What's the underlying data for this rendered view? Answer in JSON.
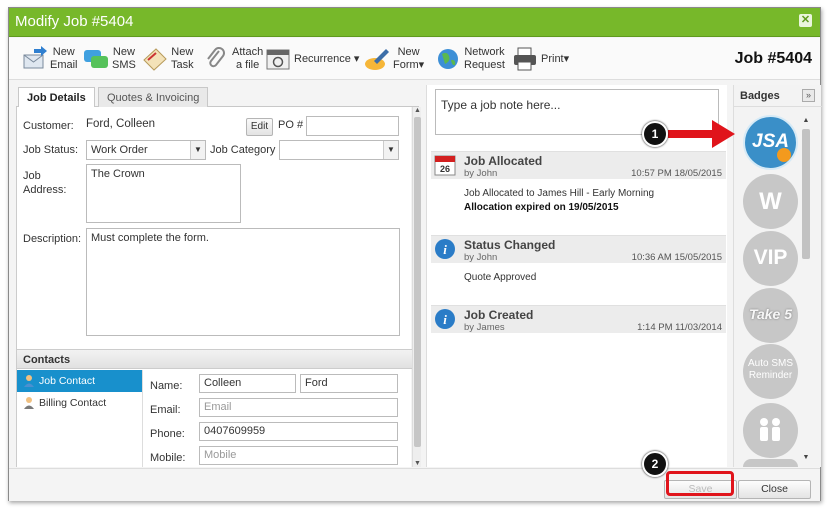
{
  "window": {
    "title": "Modify Job #5404"
  },
  "toolbar": {
    "new_email": [
      "New",
      "Email"
    ],
    "new_sms": [
      "New",
      "SMS"
    ],
    "new_task": [
      "New",
      "Task"
    ],
    "attach_file": [
      "Attach",
      "a file"
    ],
    "recurrence": "Recurrence",
    "new_form": [
      "New",
      "Form"
    ],
    "network_request": [
      "Network",
      "Request"
    ],
    "print": "Print",
    "job_number": "Job #5404"
  },
  "tabs": [
    "Job Details",
    "Quotes & Invoicing"
  ],
  "form": {
    "customer_label": "Customer:",
    "customer_value": "Ford, Colleen",
    "edit_label": "Edit",
    "po_label": "PO #",
    "po_value": "",
    "status_label": "Job Status:",
    "status_value": "Work Order",
    "category_label": "Job Category",
    "category_value": "",
    "address_label": [
      "Job",
      "Address:"
    ],
    "address_value": "The Crown",
    "description_label": "Description:",
    "description_value": "Must complete the form."
  },
  "contacts": {
    "header": "Contacts",
    "items": [
      "Job Contact",
      "Billing Contact"
    ],
    "name_label": "Name:",
    "first_name": "Colleen",
    "last_name": "Ford",
    "email_label": "Email:",
    "email_placeholder": "Email",
    "phone_label": "Phone:",
    "phone_value": "0407609959",
    "mobile_label": "Mobile:",
    "mobile_placeholder": "Mobile"
  },
  "notes": {
    "placeholder": "Type a job note here...",
    "entries": [
      {
        "title": "Job Allocated",
        "by": "by John",
        "time": "10:57 PM 18/05/2015",
        "icon_text": "26",
        "body": "Job Allocated to James Hill - Early Morning",
        "body_bold": "Allocation expired on 19/05/2015"
      },
      {
        "title": "Status Changed",
        "by": "by John",
        "time": "10:36 AM 15/05/2015",
        "body": "Quote Approved"
      },
      {
        "title": "Job Created",
        "by": "by James",
        "time": "1:14 PM 11/03/2014"
      }
    ]
  },
  "badges": {
    "header": "Badges",
    "expand": "»",
    "items": [
      "JSA",
      "W",
      "VIP",
      "Take 5",
      "Auto SMS Reminder",
      ""
    ]
  },
  "footer": {
    "save": "Save",
    "close": "Close"
  },
  "callouts": [
    "1",
    "2"
  ],
  "colors": {
    "titlebar": "#77b82a",
    "accent": "#1890cc",
    "highlight": "#e0141b"
  }
}
